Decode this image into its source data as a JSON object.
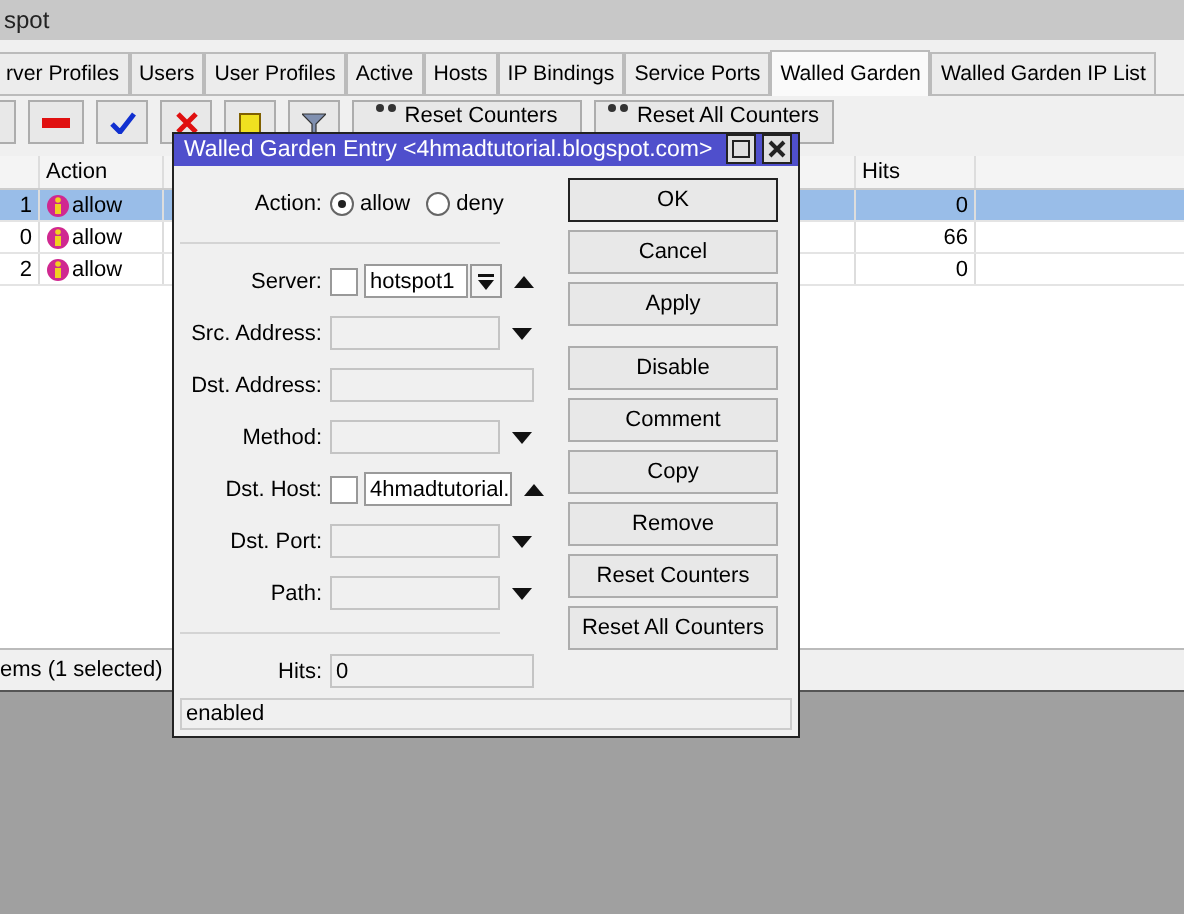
{
  "window": {
    "title": "spot"
  },
  "tabs": [
    {
      "label": "rver Profiles",
      "selected": false
    },
    {
      "label": "Users",
      "selected": false
    },
    {
      "label": "User Profiles",
      "selected": false
    },
    {
      "label": "Active",
      "selected": false
    },
    {
      "label": "Hosts",
      "selected": false
    },
    {
      "label": "IP Bindings",
      "selected": false
    },
    {
      "label": "Service Ports",
      "selected": false
    },
    {
      "label": "Walled Garden",
      "selected": true
    },
    {
      "label": "Walled Garden IP List",
      "selected": false
    }
  ],
  "toolbar": [
    {
      "kind": "stub"
    },
    {
      "kind": "remove"
    },
    {
      "kind": "enable"
    },
    {
      "kind": "disable"
    },
    {
      "kind": "comment"
    },
    {
      "kind": "filter"
    },
    {
      "kind": "text",
      "label": "Reset Counters"
    },
    {
      "kind": "text",
      "label": "Reset All Counters"
    }
  ],
  "table": {
    "columns": [
      "Action",
      "Hits"
    ],
    "rows": [
      {
        "index": "1",
        "action": "allow",
        "hits": "0",
        "selected": true
      },
      {
        "index": "0",
        "action": "allow",
        "hits": "66",
        "selected": false
      },
      {
        "index": "2",
        "action": "allow",
        "hits": "0",
        "selected": false
      }
    ]
  },
  "status_bar": "ems (1 selected)",
  "dialog": {
    "title": "Walled Garden Entry <4hmadtutorial.blogspot.com>",
    "action": {
      "label": "Action:",
      "options": [
        {
          "label": "allow",
          "selected": true
        },
        {
          "label": "deny",
          "selected": false
        }
      ]
    },
    "fields": [
      {
        "kind": "server",
        "label": "Server:",
        "value": "hotspot1",
        "checked": false
      },
      {
        "kind": "select",
        "label": "Src. Address:"
      },
      {
        "kind": "text",
        "label": "Dst. Address:"
      },
      {
        "kind": "select",
        "label": "Method:"
      },
      {
        "kind": "host",
        "label": "Dst. Host:",
        "value": "4hmadtutorial.",
        "checked": false
      },
      {
        "kind": "select",
        "label": "Dst. Port:"
      },
      {
        "kind": "select",
        "label": "Path:"
      }
    ],
    "hits": {
      "label": "Hits:",
      "value": "0"
    },
    "button_groups": [
      [
        {
          "label": "OK",
          "default": true
        },
        {
          "label": "Cancel",
          "default": false
        },
        {
          "label": "Apply",
          "default": false
        }
      ],
      [
        {
          "label": "Disable",
          "default": false
        },
        {
          "label": "Comment",
          "default": false
        },
        {
          "label": "Copy",
          "default": false
        },
        {
          "label": "Remove",
          "default": false
        },
        {
          "label": "Reset Counters",
          "default": false
        },
        {
          "label": "Reset All Counters",
          "default": false
        }
      ]
    ],
    "status": "enabled"
  }
}
